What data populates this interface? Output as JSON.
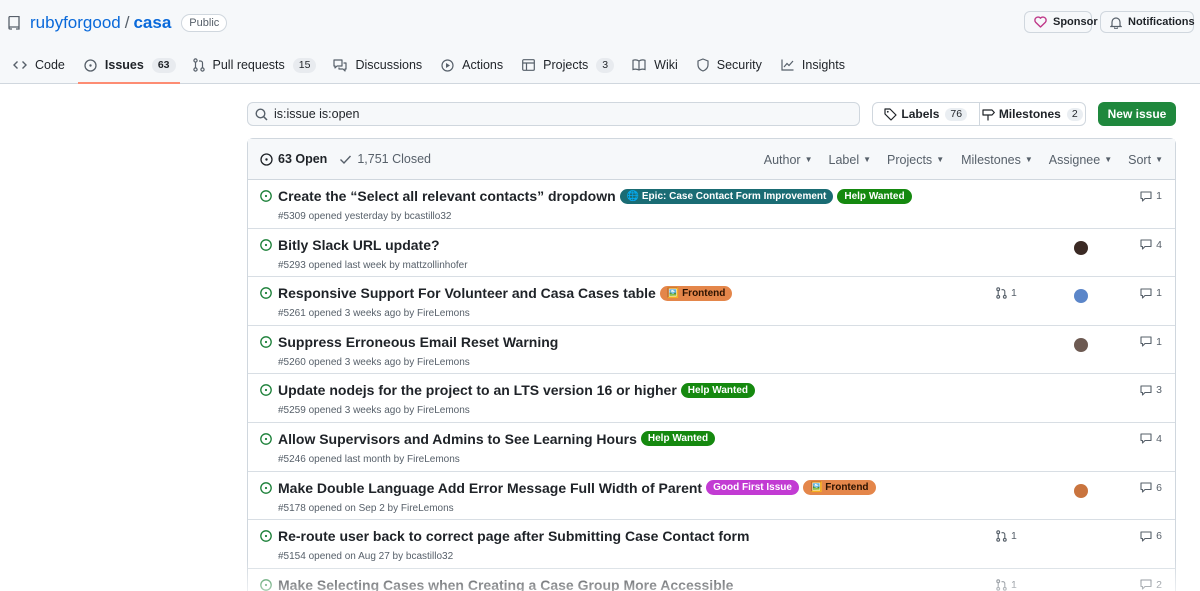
{
  "repo": {
    "owner": "rubyforgood",
    "sep": "/",
    "name": "casa",
    "visibility": "Public"
  },
  "header_buttons": {
    "sponsor": "Sponsor",
    "notifications": "Notifications"
  },
  "tabs": [
    {
      "label": "Code",
      "icon": "code-icon",
      "count": ""
    },
    {
      "label": "Issues",
      "icon": "issue-opened-icon",
      "count": "63"
    },
    {
      "label": "Pull requests",
      "icon": "pull-request-icon",
      "count": "15"
    },
    {
      "label": "Discussions",
      "icon": "comment-discussion-icon",
      "count": ""
    },
    {
      "label": "Actions",
      "icon": "play-icon",
      "count": ""
    },
    {
      "label": "Projects",
      "icon": "table-icon",
      "count": "3"
    },
    {
      "label": "Wiki",
      "icon": "book-icon",
      "count": ""
    },
    {
      "label": "Security",
      "icon": "shield-icon",
      "count": ""
    },
    {
      "label": "Insights",
      "icon": "graph-icon",
      "count": ""
    }
  ],
  "search": {
    "query": "is:issue is:open"
  },
  "labels_button": {
    "label": "Labels",
    "count": "76"
  },
  "milestones_button": {
    "label": "Milestones",
    "count": "2"
  },
  "new_issue": "New issue",
  "states": {
    "open": "63 Open",
    "closed": "1,751 Closed"
  },
  "filters": [
    "Author",
    "Label",
    "Projects",
    "Milestones",
    "Assignee",
    "Sort"
  ],
  "colors": {
    "open_green": "#1a7f37",
    "help_wanted": "#15890f",
    "frontend": "#e4864a",
    "epic": "#1a6c74",
    "good_first_issue": "#c23bd3",
    "accent": "#0969da"
  },
  "issues": [
    {
      "title": "Create the “Select all relevant contacts” dropdown",
      "meta": "#5309 opened yesterday by bcastillo32",
      "labels": [
        {
          "text": "🌐 Epic: Case Contact Form Improvement",
          "kind": "epic"
        },
        {
          "text": "Help Wanted",
          "kind": "help"
        }
      ],
      "prs": "",
      "avatar": "",
      "comments": "1"
    },
    {
      "title": "Bitly Slack URL update?",
      "meta": "#5293 opened last week by mattzollinhofer",
      "labels": [],
      "prs": "",
      "avatar": "#3b2a24",
      "comments": "4"
    },
    {
      "title": "Responsive Support For Volunteer and Casa Cases table",
      "meta": "#5261 opened 3 weeks ago by FireLemons",
      "labels": [
        {
          "text": "🖼️ Frontend",
          "kind": "frontend"
        }
      ],
      "prs": "1",
      "avatar": "#5b86c9",
      "comments": "1"
    },
    {
      "title": "Suppress Erroneous Email Reset Warning",
      "meta": "#5260 opened 3 weeks ago by FireLemons",
      "labels": [],
      "prs": "",
      "avatar": "#6d5a52",
      "comments": "1"
    },
    {
      "title": "Update nodejs for the project to an LTS version 16 or higher",
      "meta": "#5259 opened 3 weeks ago by FireLemons",
      "labels": [
        {
          "text": "Help Wanted",
          "kind": "help"
        }
      ],
      "prs": "",
      "avatar": "",
      "comments": "3"
    },
    {
      "title": "Allow Supervisors and Admins to See Learning Hours",
      "meta": "#5246 opened last month by FireLemons",
      "labels": [
        {
          "text": "Help Wanted",
          "kind": "help"
        }
      ],
      "prs": "",
      "avatar": "",
      "comments": "4"
    },
    {
      "title": "Make Double Language Add Error Message Full Width of Parent",
      "meta": "#5178 opened on Sep 2 by FireLemons",
      "labels": [
        {
          "text": "Good First Issue",
          "kind": "gfi"
        },
        {
          "text": "🖼️ Frontend",
          "kind": "frontend"
        }
      ],
      "prs": "",
      "avatar": "#c9743e",
      "comments": "6"
    },
    {
      "title": "Re-route user back to correct page after Submitting Case Contact form",
      "meta": "#5154 opened on Aug 27 by bcastillo32",
      "labels": [],
      "prs": "1",
      "avatar": "",
      "comments": "6"
    },
    {
      "title": "Make Selecting Cases when Creating a Case Group More Accessible",
      "meta": "",
      "labels": [],
      "prs": "1",
      "avatar": "",
      "comments": "2"
    }
  ]
}
